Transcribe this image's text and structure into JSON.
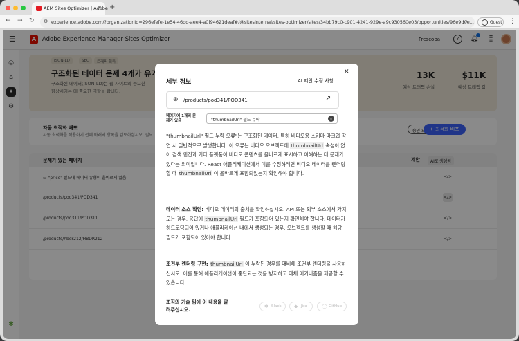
{
  "browser": {
    "tab_title": "AEM Sites Optimizer | Adobe",
    "url": "experience.adobe.com/?organizationId=296efefe-1e54-46dd-aee4-a0f94621deaf#/@sitesinternal/sites-optimizer/sites/34bb79c0-c901-4241-929e-a9c930560e03/opportunities/96e9d0e...",
    "guest_label": "Guest"
  },
  "app": {
    "title": "Adobe Experience Manager Sites Optimizer",
    "org": "Frescopa"
  },
  "hero": {
    "chips": [
      "JSON-LD",
      "SEO",
      "트래픽 획득"
    ],
    "title": "구조화된 데이터 문제 4개가 유기 검색",
    "desc_line1": "구조화된 데이터(JSON-LD)는 웹 사이트의 중요한",
    "desc_line2": "향상시키는 데 중요한 역할을 합니다.",
    "stats": [
      {
        "value": "13K",
        "label": "예상 트래픽 손실"
      },
      {
        "value": "$11K",
        "label": "예상 트래픽 값"
      }
    ]
  },
  "auto": {
    "title": "자동 최적화 배포",
    "desc": "자동 최적화를 적용하기 전에 아래의 항목을 검토하십시오. 필요",
    "approve_label": "승인 요청",
    "deploy_label": "최적화 배포"
  },
  "table": {
    "col_pages": "문제가 있는 페이지",
    "col_suggest": "제안",
    "col_ai": "AI로 생성됨",
    "rows": [
      "\"price\" 필드에 데이터 유형이 올바르지 않음",
      "/products/pod341/POD341",
      "/products/pod311/POD311",
      "/products/hbdr212/HBDR212"
    ]
  },
  "modal": {
    "title": "세부 정보",
    "subtitle": "AI 제안 수정 사항",
    "path": "/products/pod341/POD341",
    "select_label": "페이지에 1개의 문제가 있음",
    "select_value": "\"thumbnailUrl\" 필드 누락",
    "p1": {
      "a": "\"thumbnailUrl\" 필드 누락 오류\"는 구조화된 데이터, 특히 비디오용 스키마 마크업 작업 시 일반적으로 발생합니다. 이 오류는 비디오 오브젝트에 ",
      "k1": "thumbnailUrl",
      "b": " 속성이 없어 검색 엔진과 기타 플랫폼이 비디오 콘텐츠를 올바르게 표시하고 이해하는 데 문제가 있다는 의미입니다. React 애플리케이션에서 이를 수정하려면 비디오 데이터를 렌더링할 때 ",
      "k2": "thumbnailUrl",
      "c": " 이 올바르게 포함되었는지 확인해야 합니다."
    },
    "p2": {
      "head": "데이터 소스 확인:",
      "a": " 비디오 데이터의 출처를 확인하십시오. API 또는 외부 소스에서 가져오는 경우, 응답에 ",
      "k": "thumbnailUrl",
      "b": " 필드가 포함되어 있는지 확인해야 합니다. 데이터가 하드코딩되어 있거나 애플리케이션 내에서 생성되는 경우, 오브젝트를 생성할 때 해당 필드가 포함되어 있어야 합니다."
    },
    "p3": {
      "head": "조건부 렌더링 구현:",
      "k": "thumbnailUrl",
      "a": " 이 누락된 경우를 대비해 조건부 렌더링을 사용하십시오. 이를 통해 애플리케이션이 중단되는 것을 방지하고 대체 메커니즘을 제공할 수 있습니다."
    },
    "ask": "조직의 기술 팀에 이 내용을 알려주십시오.",
    "share": [
      "Slack",
      "Jira",
      "GitHub"
    ]
  }
}
